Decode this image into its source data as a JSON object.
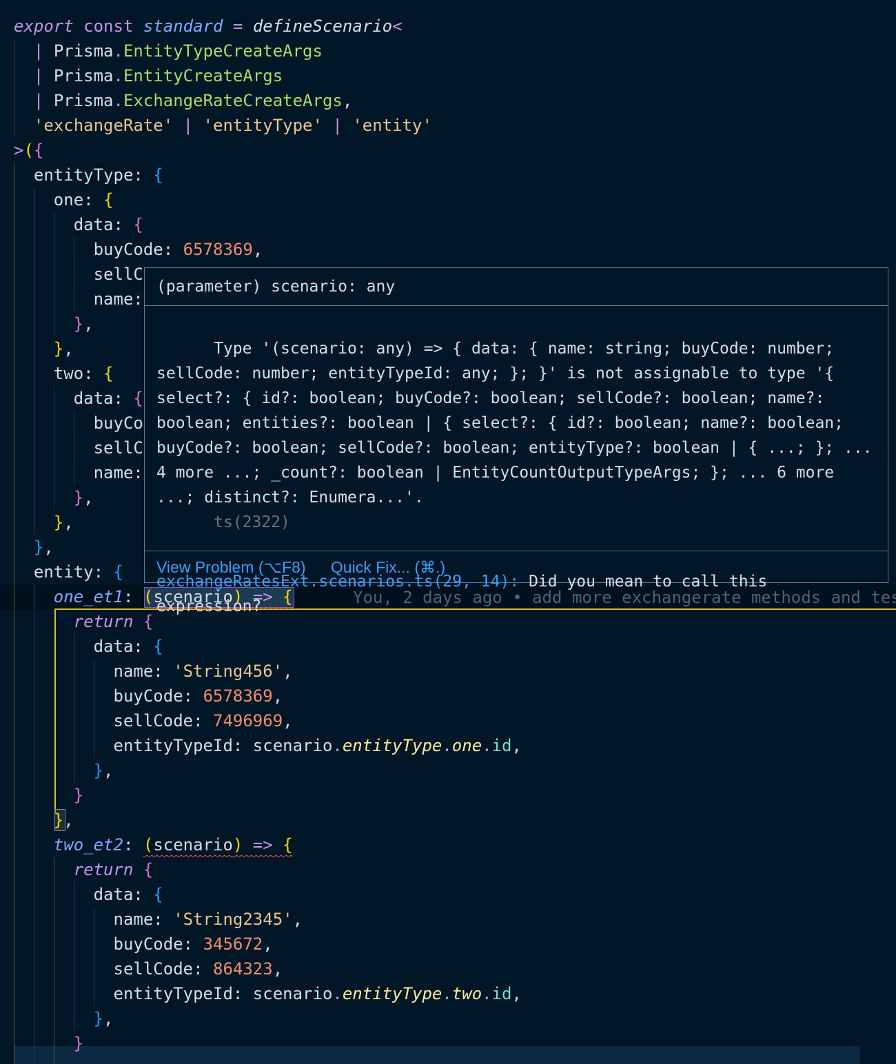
{
  "editor": {
    "lines": [
      [
        [
          "kw-italic",
          "export"
        ],
        [
          "punct",
          " "
        ],
        [
          "kw",
          "const"
        ],
        [
          "punct",
          " "
        ],
        [
          "var-italic",
          "standard"
        ],
        [
          "punct",
          " "
        ],
        [
          "op",
          "="
        ],
        [
          "punct",
          " "
        ],
        [
          "fn-italic",
          "defineScenario"
        ],
        [
          "op",
          "<"
        ]
      ],
      [
        [
          "punct",
          "  "
        ],
        [
          "pipe",
          "|"
        ],
        [
          "punct",
          " "
        ],
        [
          "prisma",
          "Prisma"
        ],
        [
          "dot",
          "."
        ],
        [
          "type",
          "EntityTypeCreateArgs"
        ]
      ],
      [
        [
          "punct",
          "  "
        ],
        [
          "pipe",
          "|"
        ],
        [
          "punct",
          " "
        ],
        [
          "prisma",
          "Prisma"
        ],
        [
          "dot",
          "."
        ],
        [
          "type",
          "EntityCreateArgs"
        ]
      ],
      [
        [
          "punct",
          "  "
        ],
        [
          "pipe",
          "|"
        ],
        [
          "punct",
          " "
        ],
        [
          "prisma",
          "Prisma"
        ],
        [
          "dot",
          "."
        ],
        [
          "type",
          "ExchangeRateCreateArgs"
        ],
        [
          "punct",
          ","
        ]
      ],
      [
        [
          "punct",
          "  "
        ],
        [
          "str",
          "'exchangeRate'"
        ],
        [
          "punct",
          " "
        ],
        [
          "pipe",
          "|"
        ],
        [
          "punct",
          " "
        ],
        [
          "str",
          "'entityType'"
        ],
        [
          "punct",
          " "
        ],
        [
          "pipe",
          "|"
        ],
        [
          "punct",
          " "
        ],
        [
          "str",
          "'entity'"
        ]
      ],
      [
        [
          "op",
          ">"
        ],
        [
          "b1",
          "("
        ],
        [
          "b2",
          "{"
        ]
      ],
      [
        [
          "punct",
          "  "
        ],
        [
          "prop",
          "entityType"
        ],
        [
          "punct",
          ": "
        ],
        [
          "b3",
          "{"
        ]
      ],
      [
        [
          "punct",
          "    "
        ],
        [
          "prop",
          "one"
        ],
        [
          "punct",
          ": "
        ],
        [
          "b1",
          "{"
        ]
      ],
      [
        [
          "punct",
          "      "
        ],
        [
          "prop",
          "data"
        ],
        [
          "punct",
          ": "
        ],
        [
          "b2",
          "{"
        ]
      ],
      [
        [
          "punct",
          "        "
        ],
        [
          "prop",
          "buyCode"
        ],
        [
          "punct",
          ": "
        ],
        [
          "num",
          "6578369"
        ],
        [
          "punct",
          ","
        ]
      ],
      [
        [
          "punct",
          "        "
        ],
        [
          "prop",
          "sellC"
        ]
      ],
      [
        [
          "punct",
          "        "
        ],
        [
          "prop",
          "name:"
        ]
      ],
      [
        [
          "punct",
          "      "
        ],
        [
          "b2",
          "}"
        ],
        [
          "punct",
          ","
        ]
      ],
      [
        [
          "punct",
          "    "
        ],
        [
          "b1",
          "}"
        ],
        [
          "punct",
          ","
        ]
      ],
      [
        [
          "punct",
          "    "
        ],
        [
          "prop",
          "two"
        ],
        [
          "punct",
          ": "
        ],
        [
          "b1",
          "{"
        ]
      ],
      [
        [
          "punct",
          "      "
        ],
        [
          "prop",
          "data"
        ],
        [
          "punct",
          ": "
        ],
        [
          "b2",
          "{"
        ]
      ],
      [
        [
          "punct",
          "        "
        ],
        [
          "prop",
          "buyCo"
        ]
      ],
      [
        [
          "punct",
          "        "
        ],
        [
          "prop",
          "sellC"
        ]
      ],
      [
        [
          "punct",
          "        "
        ],
        [
          "prop",
          "name:"
        ]
      ],
      [
        [
          "punct",
          "      "
        ],
        [
          "b2",
          "}"
        ],
        [
          "punct",
          ","
        ]
      ],
      [
        [
          "punct",
          "    "
        ],
        [
          "b1",
          "}"
        ],
        [
          "punct",
          ","
        ]
      ],
      [
        [
          "punct",
          "  "
        ],
        [
          "b3",
          "}"
        ],
        [
          "punct",
          ","
        ]
      ],
      [
        [
          "punct",
          "  "
        ],
        [
          "prop",
          "entity"
        ],
        [
          "punct",
          ": "
        ],
        [
          "b3",
          "{"
        ]
      ],
      [
        [
          "punct",
          "    "
        ],
        [
          "prop-italic2",
          "one_et1"
        ],
        [
          "punct",
          ": "
        ],
        [
          "b1",
          "("
        ],
        [
          "param squiggle",
          "scenario"
        ],
        [
          "b1 squiggle",
          ")"
        ],
        [
          "arrow squiggle",
          " =>"
        ],
        [
          "punct squiggle",
          " "
        ],
        [
          "b1 squiggle",
          "{"
        ]
      ],
      [
        [
          "punct",
          "      "
        ],
        [
          "ret",
          "return"
        ],
        [
          "punct",
          " "
        ],
        [
          "b2",
          "{"
        ]
      ],
      [
        [
          "punct",
          "        "
        ],
        [
          "prop",
          "data"
        ],
        [
          "punct",
          ": "
        ],
        [
          "b3",
          "{"
        ]
      ],
      [
        [
          "punct",
          "          "
        ],
        [
          "prop",
          "name"
        ],
        [
          "punct",
          ": "
        ],
        [
          "str",
          "'String456'"
        ],
        [
          "punct",
          ","
        ]
      ],
      [
        [
          "punct",
          "          "
        ],
        [
          "prop",
          "buyCode"
        ],
        [
          "punct",
          ": "
        ],
        [
          "num",
          "6578369"
        ],
        [
          "punct",
          ","
        ]
      ],
      [
        [
          "punct",
          "          "
        ],
        [
          "prop",
          "sellCode"
        ],
        [
          "punct",
          ": "
        ],
        [
          "num",
          "7496969"
        ],
        [
          "punct",
          ","
        ]
      ],
      [
        [
          "punct",
          "          "
        ],
        [
          "prop",
          "entityTypeId"
        ],
        [
          "punct",
          ": "
        ],
        [
          "prop",
          "scenario"
        ],
        [
          "dot",
          "."
        ],
        [
          "member-italic",
          "entityType"
        ],
        [
          "dot",
          "."
        ],
        [
          "member-italic",
          "one"
        ],
        [
          "dot",
          "."
        ],
        [
          "member",
          "id"
        ],
        [
          "punct",
          ","
        ]
      ],
      [
        [
          "punct",
          "        "
        ],
        [
          "b3",
          "}"
        ],
        [
          "punct",
          ","
        ]
      ],
      [
        [
          "punct",
          "      "
        ],
        [
          "b2",
          "}"
        ]
      ],
      [
        [
          "punct",
          "    "
        ],
        [
          "b1",
          "}"
        ],
        [
          "punct",
          ","
        ]
      ],
      [
        [
          "punct",
          "    "
        ],
        [
          "prop-italic2",
          "two_et2"
        ],
        [
          "punct",
          ": "
        ],
        [
          "b1 squiggle",
          "("
        ],
        [
          "param squiggle",
          "scenario"
        ],
        [
          "b1 squiggle",
          ")"
        ],
        [
          "arrow squiggle",
          " =>"
        ],
        [
          "punct squiggle",
          " "
        ],
        [
          "b1 squiggle",
          "{"
        ]
      ],
      [
        [
          "punct",
          "      "
        ],
        [
          "ret",
          "return"
        ],
        [
          "punct",
          " "
        ],
        [
          "b2",
          "{"
        ]
      ],
      [
        [
          "punct",
          "        "
        ],
        [
          "prop",
          "data"
        ],
        [
          "punct",
          ": "
        ],
        [
          "b3",
          "{"
        ]
      ],
      [
        [
          "punct",
          "          "
        ],
        [
          "prop",
          "name"
        ],
        [
          "punct",
          ": "
        ],
        [
          "str",
          "'String2345'"
        ],
        [
          "punct",
          ","
        ]
      ],
      [
        [
          "punct",
          "          "
        ],
        [
          "prop",
          "buyCode"
        ],
        [
          "punct",
          ": "
        ],
        [
          "num",
          "345672"
        ],
        [
          "punct",
          ","
        ]
      ],
      [
        [
          "punct",
          "          "
        ],
        [
          "prop",
          "sellCode"
        ],
        [
          "punct",
          ": "
        ],
        [
          "num",
          "864323"
        ],
        [
          "punct",
          ","
        ]
      ],
      [
        [
          "punct",
          "          "
        ],
        [
          "prop",
          "entityTypeId"
        ],
        [
          "punct",
          ": "
        ],
        [
          "prop",
          "scenario"
        ],
        [
          "dot",
          "."
        ],
        [
          "member-italic",
          "entityType"
        ],
        [
          "dot",
          "."
        ],
        [
          "member-italic",
          "two"
        ],
        [
          "dot",
          "."
        ],
        [
          "member",
          "id"
        ],
        [
          "punct",
          ","
        ]
      ],
      [
        [
          "punct",
          "        "
        ],
        [
          "b3",
          "}"
        ],
        [
          "punct",
          ","
        ]
      ],
      [
        [
          "punct",
          "      "
        ],
        [
          "b2",
          "}"
        ]
      ]
    ],
    "blame": "You, 2 days ago • add more exchangerate methods and tes"
  },
  "hover": {
    "header": "(parameter) scenario: any",
    "message": "Type '(scenario: any) => { data: { name: string; buyCode: number; sellCode: number; entityTypeId: any; }; }' is not assignable to type '{ select?: { id?: boolean; buyCode?: boolean; sellCode?: boolean; name?: boolean; entities?: boolean | { select?: { id?: boolean; name?: boolean; buyCode?: boolean; sellCode?: boolean; entityType?: boolean | { ...; }; ... 4 more ...; _count?: boolean | EntityCountOutputTypeArgs; }; ... 6 more ...; distinct?: Enumera...'.",
    "code": "ts(2322)",
    "related_link": "exchangeRatesExt.scenarios.ts(29, 14):",
    "related_text": "Did you mean to call this expression?",
    "view_problem": "View Problem (⌥F8)",
    "quick_fix": "Quick Fix... (⌘.)"
  }
}
